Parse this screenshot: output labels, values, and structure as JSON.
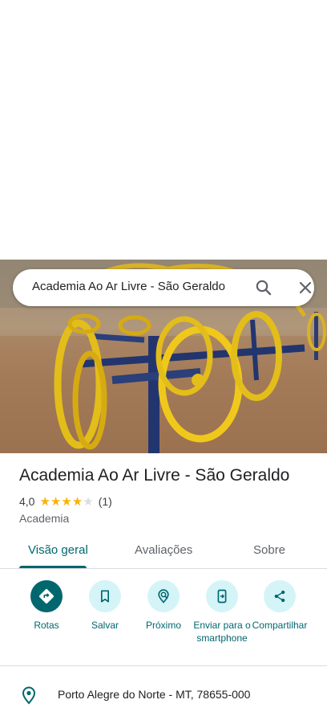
{
  "search": {
    "query": "Academia Ao Ar Livre - São Geraldo",
    "search_icon": "search-icon",
    "close_icon": "close-icon"
  },
  "place": {
    "title": "Academia Ao Ar Livre - São Geraldo",
    "rating_value": "4,0",
    "rating_fraction_filled": 0.8,
    "review_count": "(1)",
    "category": "Academia"
  },
  "tabs": [
    {
      "label": "Visão geral",
      "active": true
    },
    {
      "label": "Avaliações",
      "active": false
    },
    {
      "label": "Sobre",
      "active": false
    }
  ],
  "actions": [
    {
      "label": "Rotas",
      "icon": "directions-icon"
    },
    {
      "label": "Salvar",
      "icon": "bookmark-icon"
    },
    {
      "label": "Próximo",
      "icon": "nearby-icon"
    },
    {
      "label": "Enviar para o smartphone",
      "icon": "send-to-phone-icon"
    },
    {
      "label": "Compartilhar",
      "icon": "share-icon"
    }
  ],
  "address": {
    "text": "Porto Alegre do Norte - MT, 78655-000",
    "icon": "location-pin-icon"
  },
  "colors": {
    "accent": "#00676f",
    "accent_light": "#d4f4f8",
    "star": "#f9b400",
    "text_primary": "#202124",
    "text_secondary": "#5f6368"
  }
}
